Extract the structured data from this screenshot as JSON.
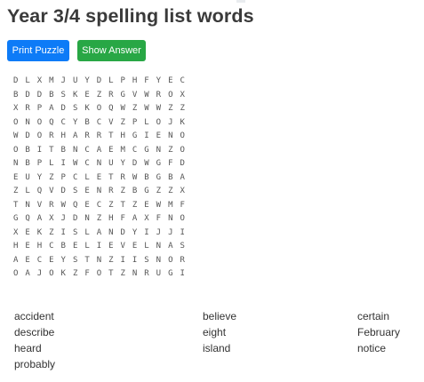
{
  "title": "Year 3/4 spelling list words",
  "buttons": {
    "print": "Print Puzzle",
    "answer": "Show Answer"
  },
  "colors": {
    "print": "#0d7bf7",
    "answer": "#28a745"
  },
  "grid": [
    "DLXMJUYDLPHFYEC",
    "BDDBSKEZRGVWROX",
    "XRPADSKOQWZWWZZ",
    "ONOQCYBCVZPLOJK",
    "WDORHARRTHGIENO",
    "OBITBNCAEMCGNZO",
    "NBPLIWCNUYDWGFD",
    "EUYZPCLETRWBGBA",
    "ZLQVDSENRZBGZZX",
    "TNVRWQECZTZEWMF",
    "GQAXJDNZHFAXFNO",
    "XEKZISLANDYIJJI",
    "HEHCBELIEVELNAS",
    "AECEYSTNZIISNOR",
    "OAJOKZFOTZNRUGI"
  ],
  "words": {
    "col1": [
      "accident",
      "describe",
      "heard",
      "probably"
    ],
    "col2": [
      "believe",
      "eight",
      "island"
    ],
    "col3": [
      "certain",
      "February",
      "notice"
    ]
  }
}
